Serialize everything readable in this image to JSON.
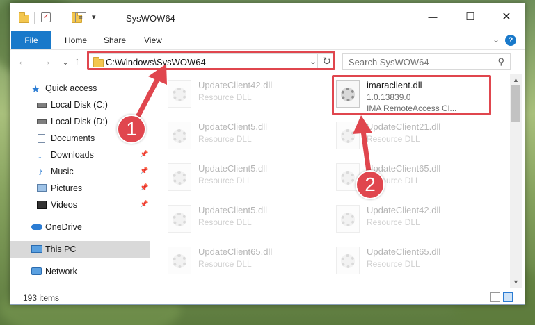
{
  "window": {
    "title": "SysWOW64",
    "minimize_glyph": "—",
    "maximize_glyph": "☐",
    "close_glyph": "✕"
  },
  "ribbon": {
    "tabs": [
      {
        "label": "File",
        "active": true
      },
      {
        "label": "Home"
      },
      {
        "label": "Share"
      },
      {
        "label": "View"
      }
    ],
    "help_glyph": "?",
    "collapse_glyph": "⌄"
  },
  "nav_buttons": {
    "back": "←",
    "forward": "→",
    "recent": "⌄",
    "up": "↑"
  },
  "address": {
    "path": "C:\\Windows\\SysWOW64",
    "dropdown_glyph": "⌄",
    "refresh_glyph": "↻"
  },
  "search": {
    "placeholder": "Search SysWOW64",
    "icon_glyph": "⚲"
  },
  "sidebar": {
    "items": [
      {
        "label": "Quick access",
        "icon": "star-icon",
        "pinned": false
      },
      {
        "label": "Local Disk (C:)",
        "icon": "drive-icon",
        "pinned": false
      },
      {
        "label": "Local Disk (D:)",
        "icon": "drive-icon",
        "pinned": false
      },
      {
        "label": "Documents",
        "icon": "documents-icon",
        "pinned": false
      },
      {
        "label": "Downloads",
        "icon": "download-icon",
        "pinned": true
      },
      {
        "label": "Music",
        "icon": "music-icon",
        "pinned": true
      },
      {
        "label": "Pictures",
        "icon": "pictures-icon",
        "pinned": true
      },
      {
        "label": "Videos",
        "icon": "videos-icon",
        "pinned": true
      },
      {
        "label": "OneDrive",
        "icon": "cloud-icon",
        "pinned": false
      },
      {
        "label": "This PC",
        "icon": "computer-icon",
        "pinned": false,
        "selected": true
      },
      {
        "label": "Network",
        "icon": "network-icon",
        "pinned": false
      }
    ],
    "pin_glyph": "📌"
  },
  "files": [
    {
      "name": "UpdateClient42.dll",
      "line2": "Resource DLL",
      "faded": true
    },
    {
      "name": "imaraclient.dll",
      "line2": "1.0.13839.0",
      "line3": "IMA RemoteAccess Cl...",
      "faded": false
    },
    {
      "name": "UpdateClient5.dll",
      "line2": "Resource DLL",
      "faded": true
    },
    {
      "name": "UpdateClient21.dll",
      "line2": "Resource DLL",
      "faded": true
    },
    {
      "name": "UpdateClient5.dll",
      "line2": "Resource DLL",
      "faded": true
    },
    {
      "name": "UpdateClient65.dll",
      "line2": "Resource DLL",
      "faded": true
    },
    {
      "name": "UpdateClient5.dll",
      "line2": "Resource DLL",
      "faded": true
    },
    {
      "name": "UpdateClient42.dll",
      "line2": "Resource DLL",
      "faded": true
    },
    {
      "name": "UpdateClient65.dll",
      "line2": "Resource DLL",
      "faded": true
    },
    {
      "name": "UpdateClient65.dll",
      "line2": "Resource DLL",
      "faded": true
    }
  ],
  "status": {
    "item_count": "193 items"
  },
  "annotations": {
    "callout_1": "1",
    "callout_2": "2",
    "color": "#e0464e"
  },
  "colors": {
    "accent": "#1979ca",
    "highlight": "#e0464e",
    "selected_bg": "#d9d9d9"
  }
}
